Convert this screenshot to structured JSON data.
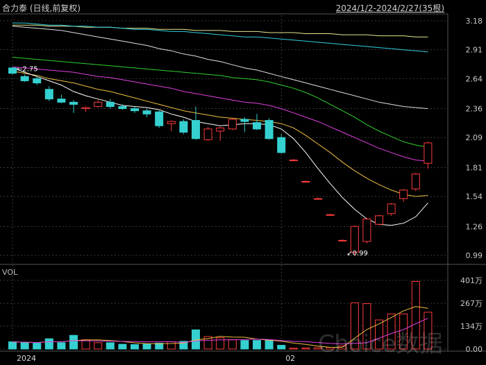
{
  "header": {
    "title": "合力泰 (日线,前复权)",
    "range": "2024/1/2-2024/2/27(35根)"
  },
  "volume_label": "VOL",
  "watermark": "Choice数据",
  "colors": {
    "up": "#ff3c3c",
    "down": "#35d0d0",
    "ma5": "#ffffff",
    "ma10": "#f0c040",
    "ma20": "#e040e0",
    "ma30": "#30d030",
    "ma60": "#e0e0e0",
    "ma120": "#30d0e0",
    "ma250": "#e8e890",
    "vol_ma5": "#f0c040",
    "vol_ma10": "#e040e0",
    "grid": "#3a3a3a"
  },
  "chart_data": {
    "type": "candlestick",
    "price_axis": {
      "ticks": [
        "3.18",
        "2.91",
        "2.64",
        "2.36",
        "2.09",
        "1.81",
        "1.54",
        "1.26",
        "0.99"
      ],
      "ylim": [
        0.99,
        3.18
      ]
    },
    "volume_axis": {
      "ticks": [
        "401万",
        "267万",
        "134万",
        "0.00"
      ],
      "ylim": [
        0,
        401
      ]
    },
    "x_labels": [
      {
        "index": 0,
        "label": "2024"
      },
      {
        "index": 22,
        "label": "02"
      }
    ],
    "annotations": [
      {
        "index": 0,
        "price": 2.75,
        "label": "2.75"
      },
      {
        "index": 27,
        "price": 0.99,
        "label": "0.99"
      }
    ],
    "candles": [
      {
        "o": 2.74,
        "h": 2.75,
        "l": 2.68,
        "c": 2.69,
        "v": 42
      },
      {
        "o": 2.66,
        "h": 2.68,
        "l": 2.61,
        "c": 2.62,
        "v": 38
      },
      {
        "o": 2.64,
        "h": 2.66,
        "l": 2.58,
        "c": 2.6,
        "v": 34
      },
      {
        "o": 2.54,
        "h": 2.57,
        "l": 2.43,
        "c": 2.45,
        "v": 60
      },
      {
        "o": 2.45,
        "h": 2.49,
        "l": 2.41,
        "c": 2.42,
        "v": 37
      },
      {
        "o": 2.42,
        "h": 2.44,
        "l": 2.32,
        "c": 2.4,
        "v": 80
      },
      {
        "o": 2.36,
        "h": 2.38,
        "l": 2.33,
        "c": 2.37,
        "v": 54
      },
      {
        "o": 2.38,
        "h": 2.44,
        "l": 2.37,
        "c": 2.42,
        "v": 37
      },
      {
        "o": 2.42,
        "h": 2.45,
        "l": 2.36,
        "c": 2.38,
        "v": 37
      },
      {
        "o": 2.38,
        "h": 2.4,
        "l": 2.35,
        "c": 2.36,
        "v": 28
      },
      {
        "o": 2.36,
        "h": 2.38,
        "l": 2.32,
        "c": 2.34,
        "v": 26
      },
      {
        "o": 2.34,
        "h": 2.36,
        "l": 2.28,
        "c": 2.31,
        "v": 30
      },
      {
        "o": 2.33,
        "h": 2.34,
        "l": 2.18,
        "c": 2.2,
        "v": 34
      },
      {
        "o": 2.22,
        "h": 2.25,
        "l": 2.15,
        "c": 2.24,
        "v": 42
      },
      {
        "o": 2.24,
        "h": 2.26,
        "l": 2.12,
        "c": 2.14,
        "v": 45
      },
      {
        "o": 2.25,
        "h": 2.38,
        "l": 2.07,
        "c": 2.08,
        "v": 112
      },
      {
        "o": 2.07,
        "h": 2.19,
        "l": 2.06,
        "c": 2.17,
        "v": 73
      },
      {
        "o": 2.15,
        "h": 2.19,
        "l": 2.06,
        "c": 2.18,
        "v": 66
      },
      {
        "o": 2.17,
        "h": 2.27,
        "l": 2.16,
        "c": 2.26,
        "v": 55
      },
      {
        "o": 2.26,
        "h": 2.28,
        "l": 2.14,
        "c": 2.24,
        "v": 50
      },
      {
        "o": 2.23,
        "h": 2.31,
        "l": 2.16,
        "c": 2.17,
        "v": 50
      },
      {
        "o": 2.25,
        "h": 2.27,
        "l": 2.07,
        "c": 2.08,
        "v": 50
      },
      {
        "o": 2.09,
        "h": 2.12,
        "l": 1.94,
        "c": 1.95,
        "v": 22
      },
      {
        "o": 1.88,
        "h": 1.89,
        "l": 1.87,
        "c": 1.88,
        "v": 5
      },
      {
        "o": 1.68,
        "h": 1.69,
        "l": 1.67,
        "c": 1.68,
        "v": 6
      },
      {
        "o": 1.52,
        "h": 1.53,
        "l": 1.51,
        "c": 1.52,
        "v": 8
      },
      {
        "o": 1.37,
        "h": 1.38,
        "l": 1.36,
        "c": 1.37,
        "v": 10
      },
      {
        "o": 1.13,
        "h": 1.14,
        "l": 1.12,
        "c": 1.13,
        "v": 18
      },
      {
        "o": 1.02,
        "h": 1.27,
        "l": 0.99,
        "c": 1.26,
        "v": 270
      },
      {
        "o": 1.12,
        "h": 1.34,
        "l": 1.1,
        "c": 1.33,
        "v": 265
      },
      {
        "o": 1.28,
        "h": 1.37,
        "l": 1.27,
        "c": 1.36,
        "v": 170
      },
      {
        "o": 1.38,
        "h": 1.48,
        "l": 1.36,
        "c": 1.47,
        "v": 205
      },
      {
        "o": 1.52,
        "h": 1.61,
        "l": 1.49,
        "c": 1.6,
        "v": 205
      },
      {
        "o": 1.61,
        "h": 1.76,
        "l": 1.59,
        "c": 1.75,
        "v": 395
      },
      {
        "o": 1.85,
        "h": 2.05,
        "l": 1.8,
        "c": 2.04,
        "v": 215
      }
    ],
    "moving_averages": [
      {
        "key": "ma5",
        "values": [
          2.74,
          2.7,
          2.66,
          2.62,
          2.58,
          2.52,
          2.48,
          2.45,
          2.42,
          2.39,
          2.38,
          2.37,
          2.35,
          2.31,
          2.28,
          2.24,
          2.22,
          2.2,
          2.21,
          2.22,
          2.22,
          2.21,
          2.17,
          2.08,
          1.95,
          1.8,
          1.66,
          1.53,
          1.42,
          1.33,
          1.28,
          1.27,
          1.29,
          1.35,
          1.48
        ]
      },
      {
        "key": "ma10",
        "values": [
          2.71,
          2.69,
          2.67,
          2.64,
          2.62,
          2.6,
          2.57,
          2.54,
          2.52,
          2.49,
          2.46,
          2.43,
          2.4,
          2.37,
          2.34,
          2.32,
          2.3,
          2.28,
          2.27,
          2.26,
          2.25,
          2.24,
          2.22,
          2.18,
          2.11,
          2.03,
          1.95,
          1.86,
          1.78,
          1.71,
          1.65,
          1.6,
          1.56,
          1.54,
          1.55
        ]
      },
      {
        "key": "ma20",
        "values": [
          2.75,
          2.74,
          2.73,
          2.72,
          2.71,
          2.7,
          2.68,
          2.66,
          2.65,
          2.63,
          2.61,
          2.59,
          2.57,
          2.55,
          2.52,
          2.5,
          2.48,
          2.46,
          2.44,
          2.42,
          2.41,
          2.39,
          2.36,
          2.32,
          2.28,
          2.24,
          2.19,
          2.14,
          2.09,
          2.04,
          1.99,
          1.95,
          1.91,
          1.88,
          1.87
        ]
      },
      {
        "key": "ma30",
        "values": [
          2.84,
          2.83,
          2.82,
          2.81,
          2.8,
          2.79,
          2.78,
          2.77,
          2.76,
          2.75,
          2.74,
          2.73,
          2.72,
          2.71,
          2.7,
          2.69,
          2.68,
          2.67,
          2.65,
          2.64,
          2.63,
          2.61,
          2.58,
          2.55,
          2.51,
          2.46,
          2.4,
          2.34,
          2.28,
          2.21,
          2.15,
          2.1,
          2.05,
          2.02,
          2.0
        ]
      },
      {
        "key": "ma60",
        "values": [
          3.13,
          3.12,
          3.11,
          3.1,
          3.09,
          3.07,
          3.05,
          3.03,
          3.01,
          2.99,
          2.97,
          2.95,
          2.92,
          2.9,
          2.87,
          2.85,
          2.82,
          2.8,
          2.77,
          2.74,
          2.72,
          2.69,
          2.66,
          2.63,
          2.6,
          2.57,
          2.54,
          2.51,
          2.48,
          2.45,
          2.42,
          2.4,
          2.38,
          2.37,
          2.36
        ]
      },
      {
        "key": "ma120",
        "values": [
          3.16,
          3.16,
          3.15,
          3.14,
          3.14,
          3.13,
          3.13,
          3.12,
          3.12,
          3.11,
          3.1,
          3.1,
          3.09,
          3.08,
          3.08,
          3.07,
          3.06,
          3.05,
          3.04,
          3.03,
          3.03,
          3.02,
          3.01,
          3.0,
          2.99,
          2.98,
          2.97,
          2.96,
          2.95,
          2.94,
          2.93,
          2.92,
          2.91,
          2.9,
          2.89
        ]
      },
      {
        "key": "ma250",
        "values": [
          3.14,
          3.14,
          3.14,
          3.13,
          3.13,
          3.13,
          3.12,
          3.12,
          3.12,
          3.11,
          3.11,
          3.11,
          3.1,
          3.1,
          3.1,
          3.09,
          3.09,
          3.09,
          3.08,
          3.08,
          3.08,
          3.07,
          3.07,
          3.07,
          3.06,
          3.06,
          3.06,
          3.05,
          3.05,
          3.05,
          3.04,
          3.04,
          3.04,
          3.03,
          3.03
        ]
      }
    ],
    "volume_moving_averages": [
      {
        "key": "vol_ma5",
        "values": [
          42,
          40,
          38,
          43,
          42,
          50,
          53,
          54,
          50,
          44,
          36,
          31,
          31,
          32,
          35,
          53,
          61,
          74,
          70,
          69,
          58,
          52,
          46,
          35,
          27,
          17,
          10,
          10,
          63,
          114,
          147,
          184,
          223,
          248,
          238
        ]
      },
      {
        "key": "vol_ma10",
        "values": [
          42,
          40,
          38,
          43,
          42,
          49,
          48,
          47,
          46,
          44,
          44,
          42,
          42,
          43,
          39,
          47,
          51,
          54,
          54,
          56,
          58,
          56,
          50,
          45,
          43,
          38,
          33,
          29,
          33,
          37,
          63,
          91,
          113,
          148,
          180
        ]
      }
    ]
  }
}
